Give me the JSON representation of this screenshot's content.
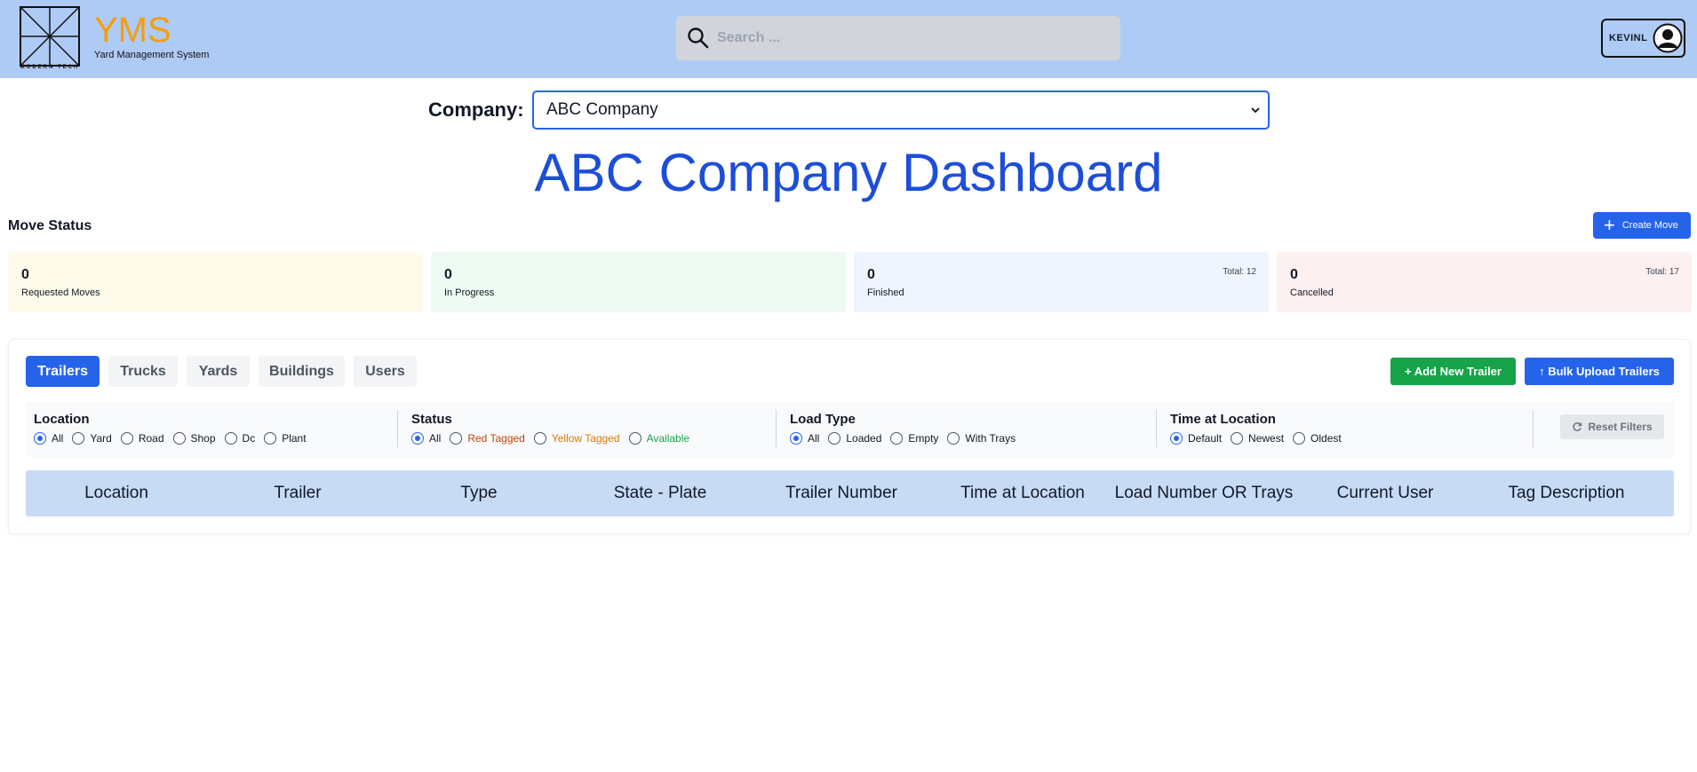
{
  "header": {
    "logo_caption": "MODERN TECH",
    "brand": "YMS",
    "brand_subtitle": "Yard Management System",
    "search_placeholder": "Search ...",
    "username": "KEVINL"
  },
  "company": {
    "label": "Company:",
    "selected": "ABC Company"
  },
  "dashboard_title": "ABC Company Dashboard",
  "move_status": {
    "heading": "Move Status",
    "create_button": "Create Move",
    "cards": [
      {
        "count": "0",
        "label": "Requested Moves",
        "total": "",
        "bg": "#fefbea"
      },
      {
        "count": "0",
        "label": "In Progress",
        "total": "",
        "bg": "#edfbf3"
      },
      {
        "count": "0",
        "label": "Finished",
        "total": "Total: 12",
        "bg": "#eef5ff"
      },
      {
        "count": "0",
        "label": "Cancelled",
        "total": "Total: 17",
        "bg": "#fdf0f0"
      }
    ]
  },
  "tabs": [
    "Trailers",
    "Trucks",
    "Yards",
    "Buildings",
    "Users"
  ],
  "active_tab": "Trailers",
  "actions": {
    "add_trailer": "+ Add New Trailer",
    "bulk_upload": "↑ Bulk Upload Trailers"
  },
  "filters": {
    "location": {
      "title": "Location",
      "options": [
        "All",
        "Yard",
        "Road",
        "Shop",
        "Dc",
        "Plant"
      ],
      "selected": "All"
    },
    "status": {
      "title": "Status",
      "options": [
        "All",
        "Red Tagged",
        "Yellow Tagged",
        "Available"
      ],
      "selected": "All"
    },
    "load_type": {
      "title": "Load Type",
      "options": [
        "All",
        "Loaded",
        "Empty",
        "With Trays"
      ],
      "selected": "All"
    },
    "time_at_location": {
      "title": "Time at Location",
      "options": [
        "Default",
        "Newest",
        "Oldest"
      ],
      "selected": "Default"
    },
    "reset_label": "Reset Filters"
  },
  "status_colors": {
    "Red Tagged": "#c2410c",
    "Yellow Tagged": "#d97706",
    "Available": "#16a34a"
  },
  "table": {
    "columns": [
      "Location",
      "Trailer",
      "Type",
      "State - Plate",
      "Trailer Number",
      "Time at Location",
      "Load Number OR Trays",
      "Current User",
      "Tag Description"
    ]
  }
}
